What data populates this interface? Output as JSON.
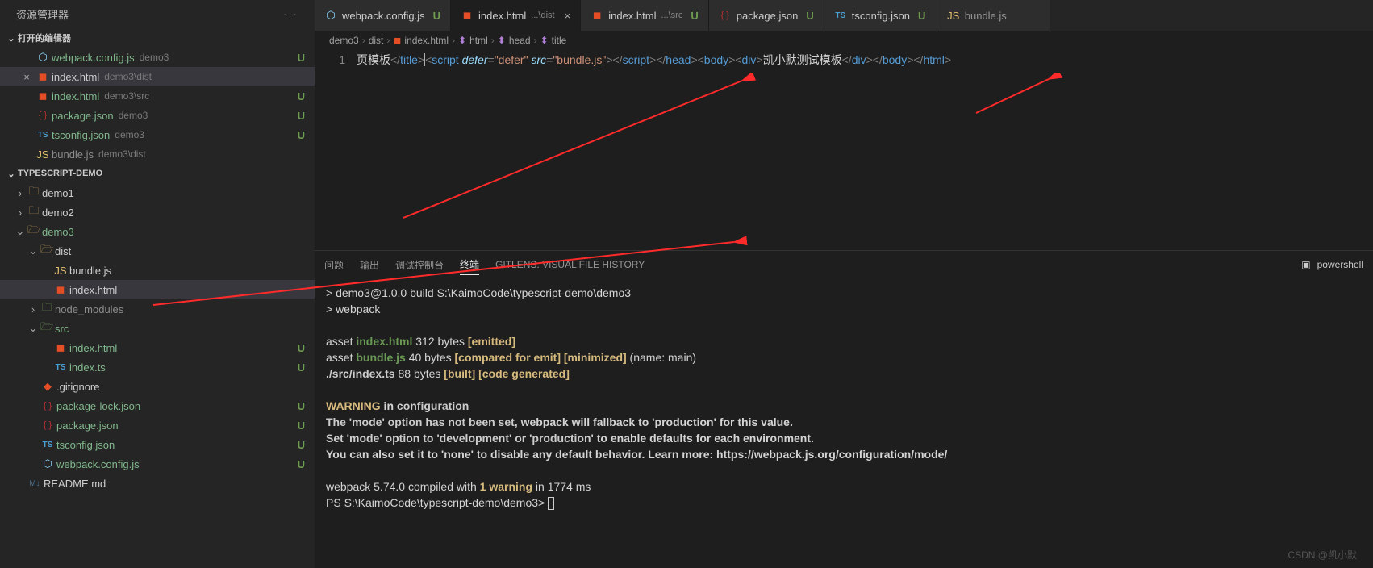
{
  "sidebar": {
    "title": "资源管理器",
    "sections": {
      "open_editors": {
        "label": "打开的编辑器",
        "items": [
          {
            "icon": "webpack",
            "name": "webpack.config.js",
            "path": "demo3",
            "status": "U",
            "name_class": "green"
          },
          {
            "icon": "html",
            "name": "index.html",
            "path": "demo3\\dist",
            "close": true,
            "active": true,
            "name_class": ""
          },
          {
            "icon": "html",
            "name": "index.html",
            "path": "demo3\\src",
            "status": "U",
            "name_class": "green"
          },
          {
            "icon": "json",
            "name": "package.json",
            "path": "demo3",
            "status": "U",
            "name_class": "green"
          },
          {
            "icon": "ts",
            "name": "tsconfig.json",
            "path": "demo3",
            "status": "U",
            "name_class": "green"
          },
          {
            "icon": "js",
            "name": "bundle.js",
            "path": "demo3\\dist",
            "name_class": "grey"
          }
        ]
      },
      "project": {
        "label": "TYPESCRIPT-DEMO"
      }
    },
    "tree": [
      {
        "type": "folder",
        "name": "demo1",
        "depth": 0,
        "open": false
      },
      {
        "type": "folder",
        "name": "demo2",
        "depth": 0,
        "open": false
      },
      {
        "type": "folder",
        "name": "demo3",
        "depth": 0,
        "open": true,
        "class": "green",
        "status": "dot"
      },
      {
        "type": "folder",
        "name": "dist",
        "depth": 1,
        "open": true
      },
      {
        "type": "file",
        "name": "bundle.js",
        "depth": 2,
        "icon": "js"
      },
      {
        "type": "file",
        "name": "index.html",
        "depth": 2,
        "icon": "html",
        "active": true
      },
      {
        "type": "folder",
        "name": "node_modules",
        "depth": 1,
        "open": false,
        "class": "grey",
        "folder_class": "green",
        "status": "grey-dot"
      },
      {
        "type": "folder",
        "name": "src",
        "depth": 1,
        "open": true,
        "class": "green",
        "folder_class": "green",
        "status": "dot"
      },
      {
        "type": "file",
        "name": "index.html",
        "depth": 2,
        "icon": "html",
        "class": "green",
        "status": "U"
      },
      {
        "type": "file",
        "name": "index.ts",
        "depth": 2,
        "icon": "ts",
        "class": "green",
        "status": "U"
      },
      {
        "type": "file",
        "name": ".gitignore",
        "depth": 1,
        "icon": "git"
      },
      {
        "type": "file",
        "name": "package-lock.json",
        "depth": 1,
        "icon": "json",
        "class": "green",
        "status": "U"
      },
      {
        "type": "file",
        "name": "package.json",
        "depth": 1,
        "icon": "json",
        "class": "green",
        "status": "U"
      },
      {
        "type": "file",
        "name": "tsconfig.json",
        "depth": 1,
        "icon": "ts",
        "class": "green",
        "status": "U"
      },
      {
        "type": "file",
        "name": "webpack.config.js",
        "depth": 1,
        "icon": "webpack",
        "class": "green",
        "status": "U"
      },
      {
        "type": "file",
        "name": "README.md",
        "depth": 0,
        "icon": "md"
      }
    ]
  },
  "tabs": [
    {
      "icon": "webpack",
      "name": "webpack.config.js",
      "status": "U"
    },
    {
      "icon": "html",
      "name": "index.html",
      "path": "...\\dist",
      "close": true,
      "active": true
    },
    {
      "icon": "html",
      "name": "index.html",
      "path": "...\\src",
      "status": "U"
    },
    {
      "icon": "json",
      "name": "package.json",
      "status": "U"
    },
    {
      "icon": "ts",
      "name": "tsconfig.json",
      "status": "U"
    },
    {
      "icon": "js",
      "name": "bundle.js",
      "inactive": true
    }
  ],
  "breadcrumb": [
    "demo3",
    "dist",
    "index.html",
    "html",
    "head",
    "title"
  ],
  "breadcrumb_icons": [
    "",
    "",
    "html",
    "cube",
    "cube",
    "cube"
  ],
  "code": {
    "line_no": "1",
    "segments": [
      {
        "t": "页模板",
        "c": "tk-txt"
      },
      {
        "t": "</",
        "c": "tk-tag"
      },
      {
        "t": "title",
        "c": "tk-name"
      },
      {
        "t": ">",
        "c": "tk-tag"
      },
      {
        "t": "<",
        "c": "tk-tag cursor-line"
      },
      {
        "t": "script",
        "c": "tk-name"
      },
      {
        "t": " defer",
        "c": "tk-attr"
      },
      {
        "t": "=",
        "c": "tk-tag"
      },
      {
        "t": "\"defer\"",
        "c": "tk-str"
      },
      {
        "t": " src",
        "c": "tk-attr"
      },
      {
        "t": "=",
        "c": "tk-tag"
      },
      {
        "t": "\"",
        "c": "tk-str"
      },
      {
        "t": "bundle.js",
        "c": "tk-str underline"
      },
      {
        "t": "\"",
        "c": "tk-str"
      },
      {
        "t": "></",
        "c": "tk-tag"
      },
      {
        "t": "script",
        "c": "tk-name"
      },
      {
        "t": "></",
        "c": "tk-tag"
      },
      {
        "t": "head",
        "c": "tk-name"
      },
      {
        "t": "><",
        "c": "tk-tag"
      },
      {
        "t": "body",
        "c": "tk-name"
      },
      {
        "t": "><",
        "c": "tk-tag"
      },
      {
        "t": "div",
        "c": "tk-name"
      },
      {
        "t": ">",
        "c": "tk-tag"
      },
      {
        "t": "凯小默测试模板",
        "c": "tk-txt"
      },
      {
        "t": "</",
        "c": "tk-tag"
      },
      {
        "t": "div",
        "c": "tk-name"
      },
      {
        "t": "></",
        "c": "tk-tag"
      },
      {
        "t": "body",
        "c": "tk-name"
      },
      {
        "t": "></",
        "c": "tk-tag"
      },
      {
        "t": "html",
        "c": "tk-name"
      },
      {
        "t": ">",
        "c": "tk-tag"
      }
    ]
  },
  "terminal": {
    "tabs": [
      "问题",
      "输出",
      "调试控制台",
      "终端",
      "GITLENS: VISUAL FILE HISTORY"
    ],
    "active_tab": 3,
    "shell": "powershell",
    "lines": [
      [
        {
          "t": "> demo3@1.0.0 build S:\\KaimoCode\\typescript-demo\\demo3",
          "c": "t-wht"
        }
      ],
      [
        {
          "t": "> webpack",
          "c": "t-wht"
        }
      ],
      [],
      [
        {
          "t": "asset ",
          "c": "t-wht"
        },
        {
          "t": "index.html",
          "c": "t-grn"
        },
        {
          "t": " 312 bytes ",
          "c": "t-wht"
        },
        {
          "t": "[emitted]",
          "c": "t-yel"
        }
      ],
      [
        {
          "t": "asset ",
          "c": "t-wht"
        },
        {
          "t": "bundle.js",
          "c": "t-grn"
        },
        {
          "t": " 40 bytes ",
          "c": "t-wht"
        },
        {
          "t": "[compared for emit]",
          "c": "t-yel"
        },
        {
          "t": " ",
          "c": ""
        },
        {
          "t": "[minimized]",
          "c": "t-yel"
        },
        {
          "t": " (name: main)",
          "c": "t-wht"
        }
      ],
      [
        {
          "t": "./src/index.ts",
          "c": "t-bold"
        },
        {
          "t": " 88 bytes ",
          "c": "t-wht"
        },
        {
          "t": "[built]",
          "c": "t-yel"
        },
        {
          "t": " ",
          "c": ""
        },
        {
          "t": "[code generated]",
          "c": "t-yel"
        }
      ],
      [],
      [
        {
          "t": "WARNING",
          "c": "t-yel"
        },
        {
          "t": " in ",
          "c": "t-wht t-bold"
        },
        {
          "t": "configuration",
          "c": "t-bold"
        }
      ],
      [
        {
          "t": "The 'mode' option has not been set",
          "c": "t-bold"
        },
        {
          "t": ", webpack will fallback to 'production' for this value.",
          "c": "t-wht t-bold"
        }
      ],
      [
        {
          "t": "Set 'mode' option to 'development' or 'production'",
          "c": "t-bold"
        },
        {
          "t": " to enable defaults for each environment.",
          "c": "t-wht t-bold"
        }
      ],
      [
        {
          "t": "You can also set it to 'none' to disable any default behavior. Learn more: https://webpack.js.org/configuration/mode/",
          "c": "t-wht t-bold"
        }
      ],
      [],
      [
        {
          "t": "webpack 5.74.0 compiled with ",
          "c": "t-wht"
        },
        {
          "t": "1 warning",
          "c": "t-yel"
        },
        {
          "t": " in 1774 ms",
          "c": "t-wht"
        }
      ],
      [
        {
          "t": "PS S:\\KaimoCode\\typescript-demo\\demo3> ",
          "c": "t-wht"
        },
        {
          "cursor": true
        }
      ]
    ]
  },
  "watermark": "CSDN @凯小默"
}
